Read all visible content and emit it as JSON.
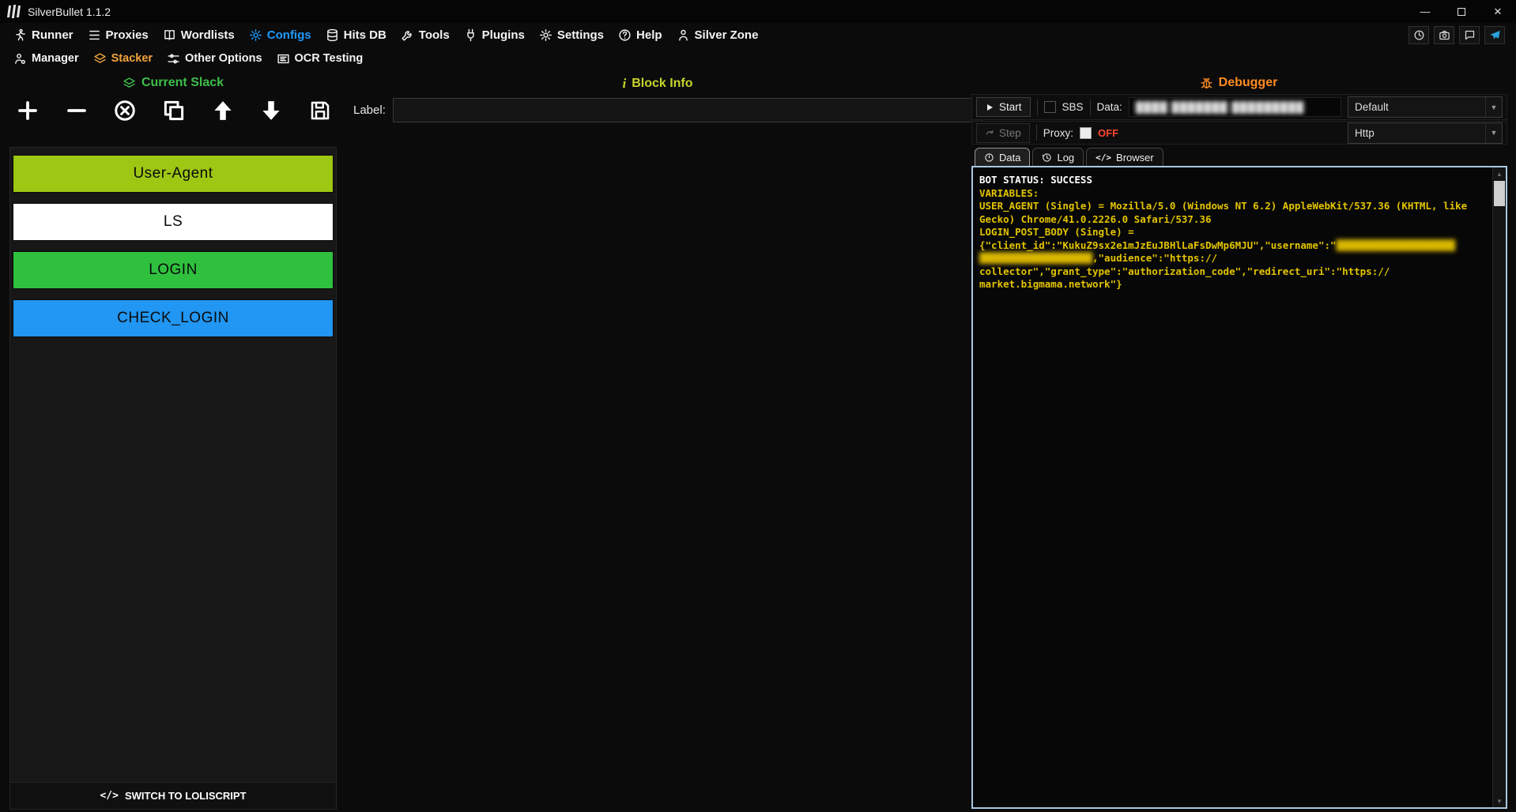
{
  "window": {
    "title": "SilverBullet 1.1.2",
    "minimize_glyph": "—",
    "close_glyph": "✕"
  },
  "icons": {
    "dropdown_arrow": "▼",
    "scroll_up": "▲",
    "scroll_down": "▼",
    "code": "</>",
    "info": "i"
  },
  "colors": {
    "accent_blue": "#1e9bff",
    "accent_orange": "#f2a43b",
    "slack_green": "#3dbf4a",
    "info_yellow": "#c6d32b",
    "debugger_orange": "#ff8b1f",
    "proxy_off_red": "#ff4632",
    "console_yellow": "#e3c400",
    "console_border": "#a9c7e0"
  },
  "menu": {
    "items": [
      "Runner",
      "Proxies",
      "Wordlists",
      "Configs",
      "Hits DB",
      "Tools",
      "Plugins",
      "Settings",
      "Help",
      "Silver Zone"
    ],
    "active": "Configs"
  },
  "submenu": {
    "items": [
      "Manager",
      "Stacker",
      "Other Options",
      "OCR Testing"
    ],
    "active": "Stacker"
  },
  "stacker": {
    "header": "Current Slack",
    "label_caption": "Label:",
    "label_value": "",
    "blocks": [
      {
        "name": "User-Agent",
        "color": "#9dc713"
      },
      {
        "name": "LS",
        "color": "#ffffff"
      },
      {
        "name": "LOGIN",
        "color": "#2fc13e"
      },
      {
        "name": "CHECK_LOGIN",
        "color": "#2196f3"
      }
    ],
    "switch_button": "SWITCH TO LOLISCRIPT"
  },
  "block_info": {
    "header": "Block Info"
  },
  "debugger": {
    "header": "Debugger",
    "start": "Start",
    "step": "Step",
    "sbs": "SBS",
    "data_caption": "Data:",
    "data_mode": "Default",
    "data_value_redacted": "████ ███████ █████████",
    "proxy_caption": "Proxy:",
    "proxy_state": "OFF",
    "proxy_type": "Http",
    "tabs": [
      "Data",
      "Log",
      "Browser"
    ],
    "active_tab": "Data",
    "console": {
      "lines": [
        {
          "cls": "status",
          "text": "BOT STATUS: SUCCESS"
        },
        {
          "text": "VARIABLES:"
        },
        {
          "text": "USER_AGENT (Single) = Mozilla/5.0 (Windows NT 6.2) AppleWebKit/537.36 (KHTML, like"
        },
        {
          "text": "Gecko) Chrome/41.0.2226.0 Safari/537.36"
        },
        {
          "text": "LOGIN_POST_BODY (Single) ="
        },
        {
          "segments": [
            {
              "text": "{\"client_id\":\"KukuZ9sx2e1mJzEuJBHlLaFsDwMp6MJU\",\"username\":\""
            },
            {
              "text": "████████████████████",
              "blur": true
            }
          ]
        },
        {
          "segments": [
            {
              "text": "███████████████████",
              "blur": true
            },
            {
              "text": ",\"audience\":\"https://"
            }
          ]
        },
        {
          "text": "collector\",\"grant_type\":\"authorization_code\",\"redirect_uri\":\"https://"
        },
        {
          "text": "market.bigmama.network\"}"
        }
      ]
    }
  }
}
